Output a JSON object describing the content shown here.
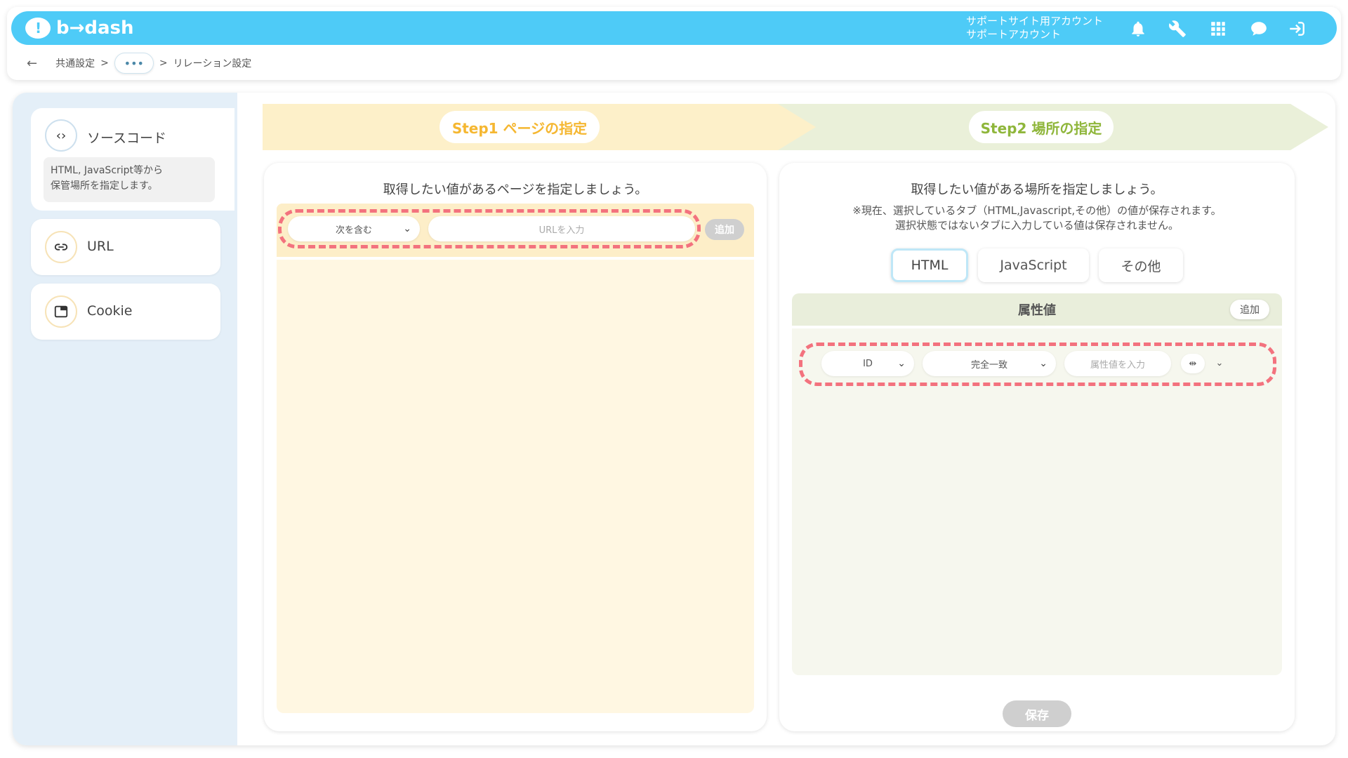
{
  "app": {
    "logo_text": "b→dash"
  },
  "header": {
    "account_line1": "サポートサイト用アカウント",
    "account_line2": "サポートアカウント",
    "icons": [
      "bell-icon",
      "wrench-icon",
      "apps-grid-icon",
      "chat-icon",
      "logout-icon"
    ]
  },
  "breadcrumb": {
    "back": "←",
    "item1": "共通設定",
    "sep1": ">",
    "more": "•••",
    "sep2": ">",
    "current": "リレーション設定"
  },
  "sidebar": {
    "items": [
      {
        "label": "ソースコード",
        "icon": "code-icon",
        "description_line1": "HTML, JavaScript等から",
        "description_line2": "保管場所を指定します。"
      },
      {
        "label": "URL",
        "icon": "link-icon"
      },
      {
        "label": "Cookie",
        "icon": "window-icon"
      }
    ]
  },
  "steps": {
    "step1": "Step1 ページの指定",
    "step2": "Step2 場所の指定"
  },
  "step1_panel": {
    "title": "取得したい値があるページを指定しましょう。",
    "condition_select": "次を含む",
    "url_placeholder": "URLを入力",
    "add_button": "追加"
  },
  "step2_panel": {
    "title": "取得したい値がある場所を指定しましょう。",
    "note_line1": "※現在、選択しているタブ（HTML,Javascript,その他）の値が保存されます。",
    "note_line2": "選択状態ではないタブに入力している値は保存されません。",
    "tabs": [
      "HTML",
      "JavaScript",
      "その他"
    ],
    "active_tab": "HTML",
    "attr_header": "属性値",
    "attr_add_button": "追加",
    "attr_type_select": "ID",
    "match_select": "完全一致",
    "attr_value_placeholder": "属性値を入力",
    "save_button": "保存"
  },
  "colors": {
    "header_bg": "#4ecbf7",
    "step1_color": "#f5b731",
    "step2_color": "#8fb63b",
    "highlight_dash": "#f3727e"
  }
}
